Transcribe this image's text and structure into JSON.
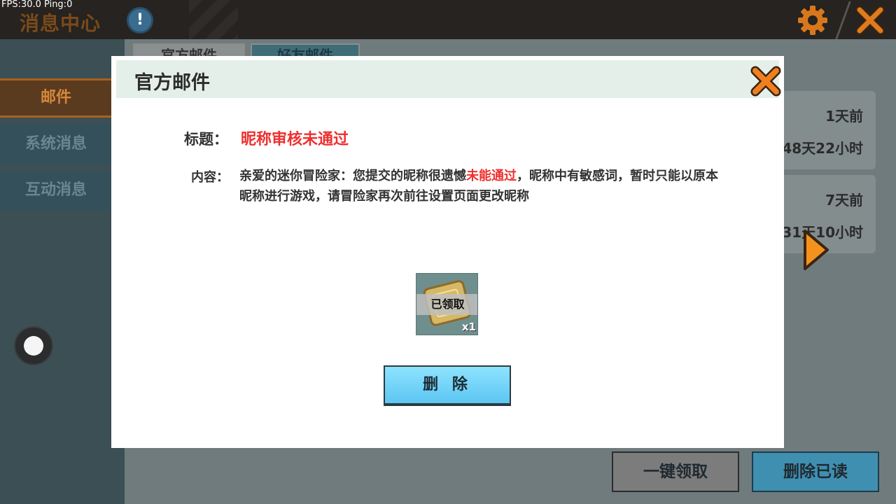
{
  "debug": {
    "fps_ping": "FPS:30.0  Ping:0"
  },
  "topbar": {
    "title": "消息中心",
    "info_glyph": "!"
  },
  "sidebar": {
    "items": [
      {
        "label": "邮件",
        "active": true
      },
      {
        "label": "系统消息",
        "active": false
      },
      {
        "label": "互动消息",
        "active": false
      }
    ]
  },
  "background_tabs": [
    {
      "label": "官方邮件"
    },
    {
      "label": "好友邮件"
    }
  ],
  "mail_list": [
    {
      "time": "1天前",
      "expire": "48天22小时"
    },
    {
      "time": "7天前",
      "expire": "31天10小时"
    }
  ],
  "bottom_buttons": {
    "claim_all": "一键领取",
    "delete_read": "删除已读"
  },
  "modal": {
    "title": "官方邮件",
    "subject_label": "标题：",
    "subject_value": "昵称审核未通过",
    "content_label": "内容：",
    "content_part1": "亲爱的迷你冒险家：您提交的昵称很遗憾",
    "content_highlight": "未能通过",
    "content_part2": "，昵称中有敏感词，暂时只能以原本昵称进行游戏，请冒险家再次前往设置页面更改昵称",
    "reward": {
      "status": "已领取",
      "count": "x1"
    },
    "delete_label": "删 除"
  },
  "colors": {
    "accent_orange": "#f07f1f",
    "highlight_red": "#ef2f2f",
    "button_blue": "#5cc6f2"
  }
}
